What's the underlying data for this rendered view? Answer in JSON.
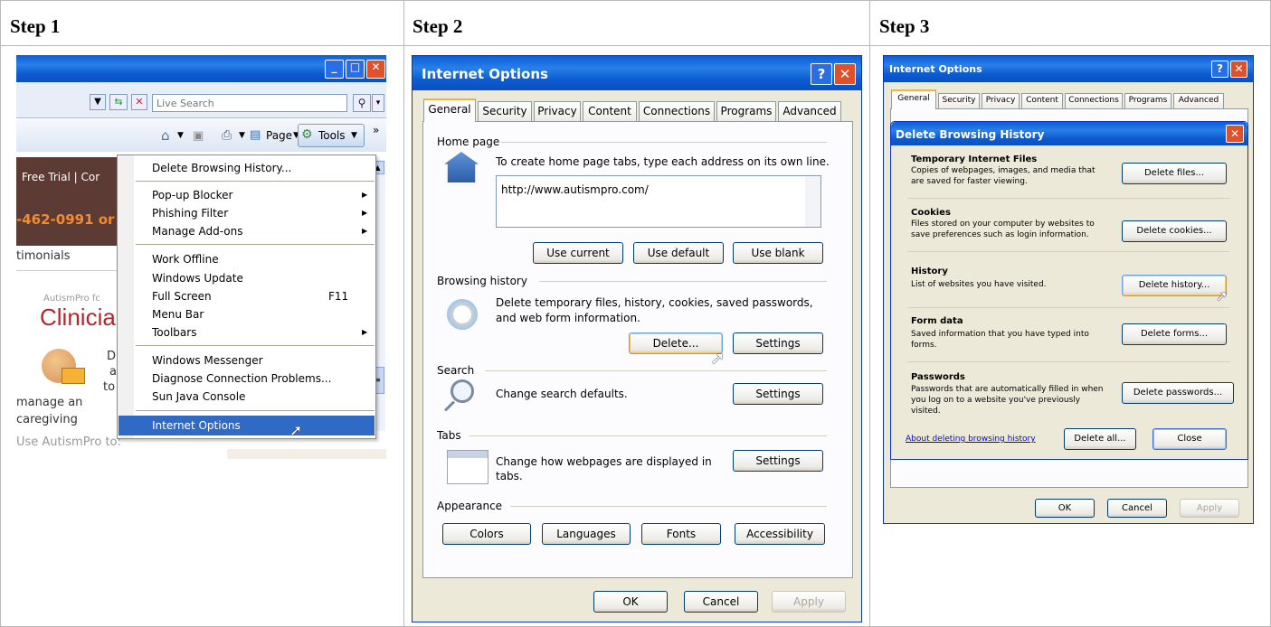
{
  "steps": [
    "Step 1",
    "Step 2",
    "Step 3"
  ],
  "step1": {
    "search_placeholder": "Live Search",
    "toolbar": {
      "page": "Page",
      "tools": "Tools",
      "more": "»"
    },
    "page_text": {
      "free_trial": "Free Trial | Cor",
      "phone": "-462-0991 or",
      "testimonials": "timonials",
      "autismpro": "AutismPro fc",
      "clinician": "Clinicia",
      "d1": "D",
      "d2": "a",
      "d3": "to",
      "manage": "manage an",
      "caregiving": "caregiving",
      "use": "Use AutismPro to:"
    },
    "menu": [
      {
        "label": "Delete Browsing History...",
        "shortcut": "",
        "submenu": false
      },
      {
        "label": "Pop-up Blocker",
        "shortcut": "",
        "submenu": true
      },
      {
        "label": "Phishing Filter",
        "shortcut": "",
        "submenu": true
      },
      {
        "label": "Manage Add-ons",
        "shortcut": "",
        "submenu": true
      },
      {
        "label": "Work Offline",
        "shortcut": "",
        "submenu": false
      },
      {
        "label": "Windows Update",
        "shortcut": "",
        "submenu": false
      },
      {
        "label": "Full Screen",
        "shortcut": "F11",
        "submenu": false
      },
      {
        "label": "Menu Bar",
        "shortcut": "",
        "submenu": false
      },
      {
        "label": "Toolbars",
        "shortcut": "",
        "submenu": true
      },
      {
        "label": "Windows Messenger",
        "shortcut": "",
        "submenu": false
      },
      {
        "label": "Diagnose Connection Problems...",
        "shortcut": "",
        "submenu": false
      },
      {
        "label": "Sun Java Console",
        "shortcut": "",
        "submenu": false
      },
      {
        "label": "Internet Options",
        "shortcut": "",
        "submenu": false
      }
    ]
  },
  "step2": {
    "title": "Internet Options",
    "tabs": [
      "General",
      "Security",
      "Privacy",
      "Content",
      "Connections",
      "Programs",
      "Advanced"
    ],
    "home": {
      "label": "Home page",
      "desc": "To create home page tabs, type each address on its own line.",
      "url": "http://www.autismpro.com/",
      "buttons": [
        "Use current",
        "Use default",
        "Use blank"
      ]
    },
    "history": {
      "label": "Browsing history",
      "desc1": "Delete temporary files, history, cookies, saved passwords,",
      "desc2": "and web form information.",
      "delete": "Delete...",
      "settings": "Settings"
    },
    "search": {
      "label": "Search",
      "desc": "Change search defaults.",
      "settings": "Settings"
    },
    "tabs_group": {
      "label": "Tabs",
      "desc1": "Change how webpages are displayed in",
      "desc2": "tabs.",
      "settings": "Settings"
    },
    "appearance": {
      "label": "Appearance",
      "buttons": [
        "Colors",
        "Languages",
        "Fonts",
        "Accessibility"
      ]
    },
    "footer": {
      "ok": "OK",
      "cancel": "Cancel",
      "apply": "Apply"
    }
  },
  "step3": {
    "title": "Internet Options",
    "tabs": [
      "General",
      "Security",
      "Privacy",
      "Content",
      "Connections",
      "Programs",
      "Advanced"
    ],
    "dialog_title": "Delete Browsing History",
    "sections": [
      {
        "heading": "Temporary Internet Files",
        "lines": [
          "Copies of webpages, images, and media that",
          "are saved for faster viewing."
        ],
        "button": "Delete files..."
      },
      {
        "heading": "Cookies",
        "lines": [
          "Files stored on your computer by websites to",
          "save preferences such as login information."
        ],
        "button": "Delete cookies..."
      },
      {
        "heading": "History",
        "lines": [
          "List of websites you have visited."
        ],
        "button": "Delete history..."
      },
      {
        "heading": "Form data",
        "lines": [
          "Saved information that you have typed into",
          "forms."
        ],
        "button": "Delete forms..."
      },
      {
        "heading": "Passwords",
        "lines": [
          "Passwords that are automatically filled in when",
          "you log on to a website you've previously",
          "visited."
        ],
        "button": "Delete passwords..."
      }
    ],
    "link": "About deleting browsing history",
    "delete_all": "Delete all...",
    "close": "Close",
    "footer": {
      "ok": "OK",
      "cancel": "Cancel",
      "apply": "Apply"
    }
  }
}
